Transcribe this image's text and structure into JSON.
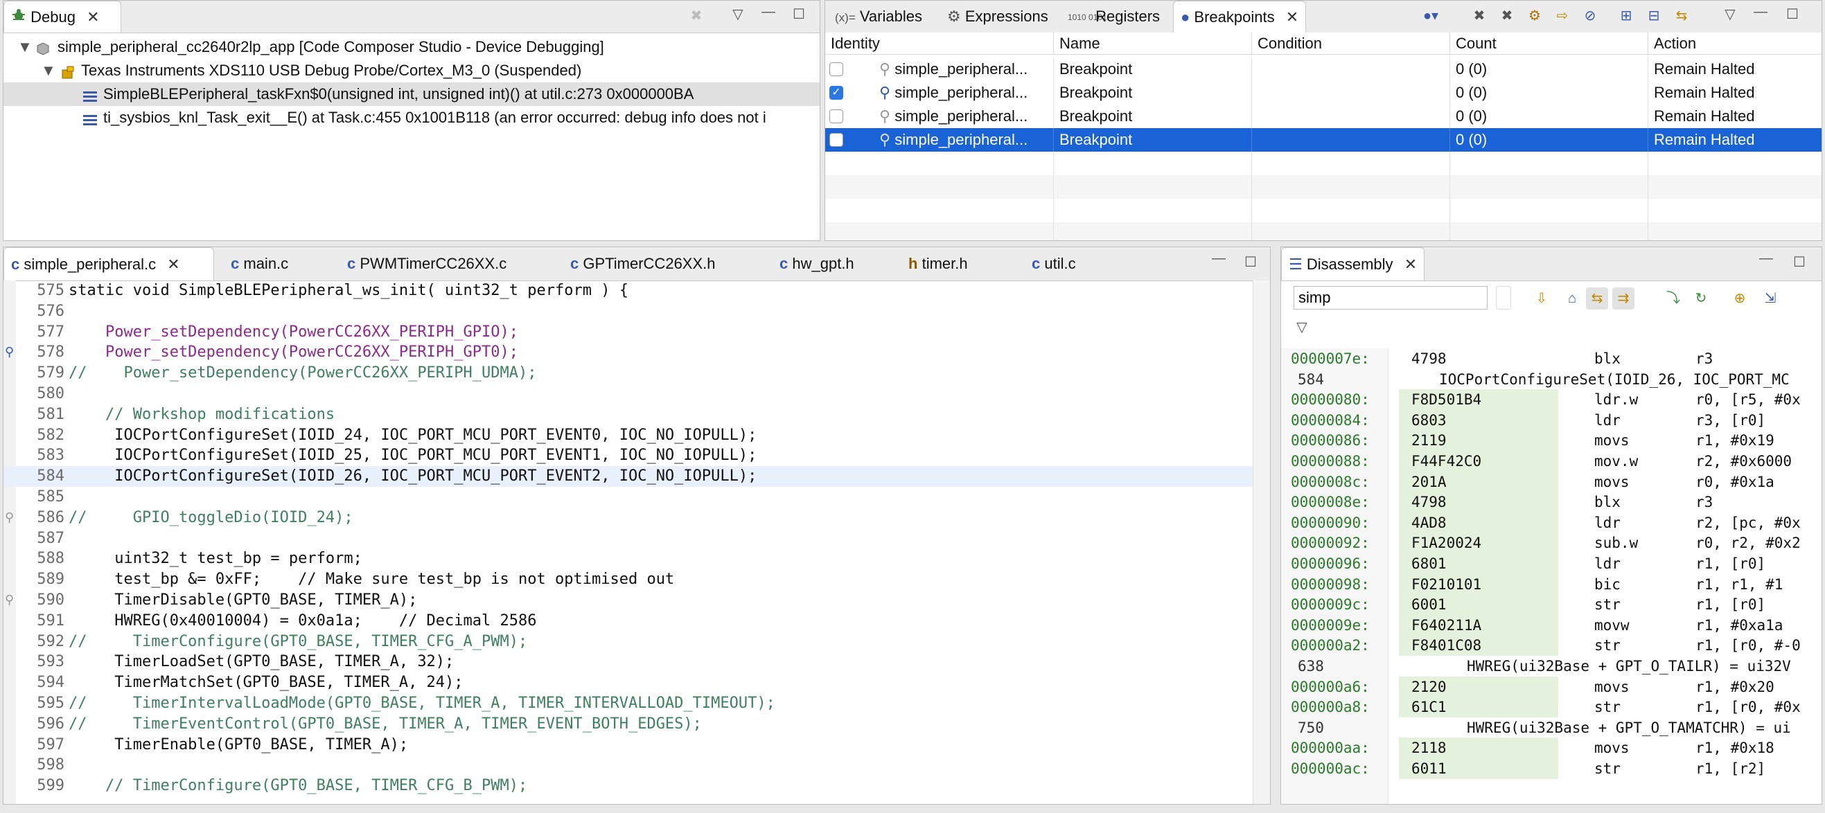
{
  "debug": {
    "tab_label": "Debug",
    "tree": [
      {
        "text": "simple_peripheral_cc2640r2lp_app [Code Composer Studio - Device Debugging]",
        "icon": "launch-config-icon"
      },
      {
        "text": "Texas Instruments XDS110 USB Debug Probe/Cortex_M3_0 (Suspended)",
        "icon": "target-suspended-icon"
      },
      {
        "text": "SimpleBLEPeripheral_taskFxn$0(unsigned int, unsigned int)() at util.c:273 0x000000BA",
        "icon": "stack-frame-icon",
        "selected": true
      },
      {
        "text": "ti_sysbios_knl_Task_exit__E() at Task.c:455 0x1001B118  (an error occurred: debug info does not i",
        "icon": "stack-frame-icon"
      }
    ]
  },
  "views_tabs": [
    {
      "label": "Variables",
      "prefix": "(x)="
    },
    {
      "label": "Expressions"
    },
    {
      "label": "Registers",
      "prefix": "1010 0101"
    },
    {
      "label": "Breakpoints",
      "active": true
    }
  ],
  "breakpoints": {
    "columns": [
      "Identity",
      "Name",
      "Condition",
      "Count",
      "Action"
    ],
    "rows": [
      {
        "checked": false,
        "identity": "simple_peripheral...",
        "name": "Breakpoint",
        "condition": "",
        "count": "0 (0)",
        "action": "Remain Halted"
      },
      {
        "checked": true,
        "identity": "simple_peripheral...",
        "name": "Breakpoint",
        "condition": "",
        "count": "0 (0)",
        "action": "Remain Halted"
      },
      {
        "checked": false,
        "identity": "simple_peripheral...",
        "name": "Breakpoint",
        "condition": "",
        "count": "0 (0)",
        "action": "Remain Halted"
      },
      {
        "checked": false,
        "identity": "simple_peripheral...",
        "name": "Breakpoint",
        "condition": "",
        "count": "0 (0)",
        "action": "Remain Halted",
        "selected": true
      }
    ]
  },
  "editor": {
    "tabs": [
      "simple_peripheral.c",
      "main.c",
      "PWMTimerCC26XX.c",
      "GPTimerCC26XX.h",
      "hw_gpt.h",
      "timer.h",
      "util.c"
    ],
    "active_tab": 0,
    "lines": [
      {
        "n": "575",
        "text": "static void SimpleBLEPeripheral_ws_init( uint32_t perform ) {"
      },
      {
        "n": "576",
        "text": ""
      },
      {
        "n": "577",
        "text": "    Power_setDependency(PowerCC26XX_PERIPH_GPIO);"
      },
      {
        "n": "578",
        "text": "    Power_setDependency(PowerCC26XX_PERIPH_GPT0);",
        "marker": "breakpoint"
      },
      {
        "n": "579",
        "text": "//    Power_setDependency(PowerCC26XX_PERIPH_UDMA);"
      },
      {
        "n": "580",
        "text": ""
      },
      {
        "n": "581",
        "text": "    // Workshop modifications"
      },
      {
        "n": "582",
        "text": "     IOCPortConfigureSet(IOID_24, IOC_PORT_MCU_PORT_EVENT0, IOC_NO_IOPULL);"
      },
      {
        "n": "583",
        "text": "     IOCPortConfigureSet(IOID_25, IOC_PORT_MCU_PORT_EVENT1, IOC_NO_IOPULL);"
      },
      {
        "n": "584",
        "text": "     IOCPortConfigureSet(IOID_26, IOC_PORT_MCU_PORT_EVENT2, IOC_NO_IOPULL);",
        "highlight": true
      },
      {
        "n": "585",
        "text": ""
      },
      {
        "n": "586",
        "text": "//     GPIO_toggleDio(IOID_24);",
        "marker": "disabled"
      },
      {
        "n": "587",
        "text": ""
      },
      {
        "n": "588",
        "text": "     uint32_t test_bp = perform;"
      },
      {
        "n": "589",
        "text": "     test_bp &= 0xFF;    // Make sure test_bp is not optimised out"
      },
      {
        "n": "590",
        "text": "     TimerDisable(GPT0_BASE, TIMER_A);",
        "marker": "disabled"
      },
      {
        "n": "591",
        "text": "     HWREG(0x40010004) = 0x0a1a;    // Decimal 2586"
      },
      {
        "n": "592",
        "text": "//     TimerConfigure(GPT0_BASE, TIMER_CFG_A_PWM);"
      },
      {
        "n": "593",
        "text": "     TimerLoadSet(GPT0_BASE, TIMER_A, 32);"
      },
      {
        "n": "594",
        "text": "     TimerMatchSet(GPT0_BASE, TIMER_A, 24);"
      },
      {
        "n": "595",
        "text": "//     TimerIntervalLoadMode(GPT0_BASE, TIMER_A, TIMER_INTERVALLOAD_TIMEOUT);"
      },
      {
        "n": "596",
        "text": "//     TimerEventControl(GPT0_BASE, TIMER_A, TIMER_EVENT_BOTH_EDGES);"
      },
      {
        "n": "597",
        "text": "     TimerEnable(GPT0_BASE, TIMER_A);"
      },
      {
        "n": "598",
        "text": ""
      },
      {
        "n": "599",
        "text": "    // TimerConfigure(GPT0_BASE, TIMER_CFG_B_PWM);"
      }
    ]
  },
  "disassembly": {
    "tab_label": "Disassembly",
    "search_value": "simp",
    "lines": [
      {
        "kind": "ins",
        "addr": "0000007e:",
        "hex": "4798",
        "mn": "blx",
        "op": "r3"
      },
      {
        "kind": "src",
        "n": "584",
        "text": "IOCPortConfigureSet(IOID_26, IOC_PORT_MC"
      },
      {
        "kind": "ins",
        "addr": "00000080:",
        "hex": "F8D501B4",
        "mn": "ldr.w",
        "op": "r0, [r5, #0x",
        "green": true
      },
      {
        "kind": "ins",
        "addr": "00000084:",
        "hex": "6803",
        "mn": "ldr",
        "op": "r3, [r0]",
        "green": true
      },
      {
        "kind": "ins",
        "addr": "00000086:",
        "hex": "2119",
        "mn": "movs",
        "op": "r1, #0x19",
        "green": true
      },
      {
        "kind": "ins",
        "addr": "00000088:",
        "hex": "F44F42C0",
        "mn": "mov.w",
        "op": "r2, #0x6000",
        "green": true
      },
      {
        "kind": "ins",
        "addr": "0000008c:",
        "hex": "201A",
        "mn": "movs",
        "op": "r0, #0x1a",
        "green": true
      },
      {
        "kind": "ins",
        "addr": "0000008e:",
        "hex": "4798",
        "mn": "blx",
        "op": "r3",
        "green": true
      },
      {
        "kind": "ins",
        "addr": "00000090:",
        "hex": "4AD8",
        "mn": "ldr",
        "op": "r2, [pc, #0x",
        "green": true
      },
      {
        "kind": "ins",
        "addr": "00000092:",
        "hex": "F1A20024",
        "mn": "sub.w",
        "op": "r0, r2, #0x2",
        "green": true
      },
      {
        "kind": "ins",
        "addr": "00000096:",
        "hex": "6801",
        "mn": "ldr",
        "op": "r1, [r0]",
        "green": true
      },
      {
        "kind": "ins",
        "addr": "00000098:",
        "hex": "F0210101",
        "mn": "bic",
        "op": "r1, r1, #1",
        "green": true
      },
      {
        "kind": "ins",
        "addr": "0000009c:",
        "hex": "6001",
        "mn": "str",
        "op": "r1, [r0]",
        "green": true
      },
      {
        "kind": "ins",
        "addr": "0000009e:",
        "hex": "F640211A",
        "mn": "movw",
        "op": "r1, #0xa1a",
        "green": true
      },
      {
        "kind": "ins",
        "addr": "000000a2:",
        "hex": "F8401C08",
        "mn": "str",
        "op": "r1, [r0, #-0",
        "green": true
      },
      {
        "kind": "src",
        "n": "638",
        "text": "HWREG(ui32Base + GPT_O_TAILR) = ui32V"
      },
      {
        "kind": "ins",
        "addr": "000000a6:",
        "hex": "2120",
        "mn": "movs",
        "op": "r1, #0x20",
        "green": true
      },
      {
        "kind": "ins",
        "addr": "000000a8:",
        "hex": "61C1",
        "mn": "str",
        "op": "r1, [r0, #0x",
        "green": true
      },
      {
        "kind": "src",
        "n": "750",
        "text": "HWREG(ui32Base + GPT_O_TAMATCHR) = ui"
      },
      {
        "kind": "ins",
        "addr": "000000aa:",
        "hex": "2118",
        "mn": "movs",
        "op": "r1, #0x18",
        "green": true
      },
      {
        "kind": "ins",
        "addr": "000000ac:",
        "hex": "6011",
        "mn": "str",
        "op": "r1, [r2]",
        "green": true
      }
    ]
  }
}
